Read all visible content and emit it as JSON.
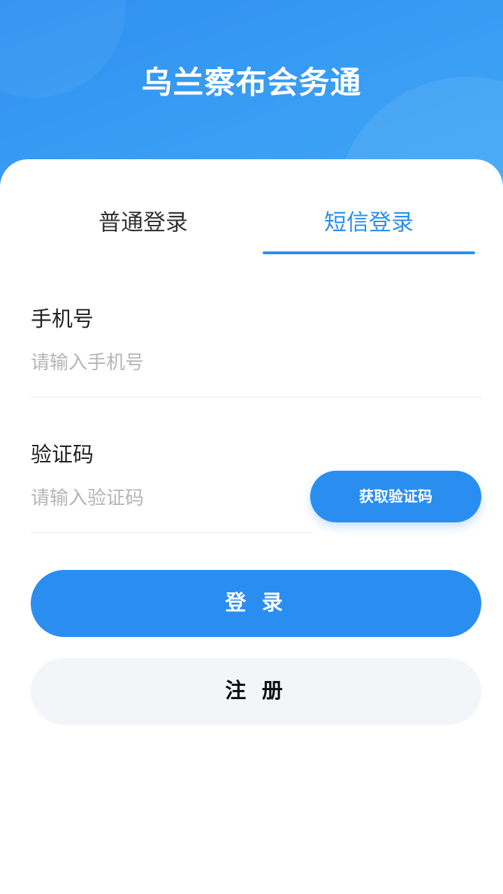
{
  "header": {
    "title": "乌兰察布会务通"
  },
  "tabs": [
    {
      "label": "普通登录",
      "active": false
    },
    {
      "label": "短信登录",
      "active": true
    }
  ],
  "form": {
    "phone": {
      "label": "手机号",
      "placeholder": "请输入手机号",
      "value": ""
    },
    "code": {
      "label": "验证码",
      "placeholder": "请输入验证码",
      "value": "",
      "button_label": "获取验证码"
    }
  },
  "actions": {
    "login_label": "登 录",
    "register_label": "注 册"
  },
  "colors": {
    "accent": "#2a8ef0",
    "header_gradient_start": "#2f8ff0",
    "header_gradient_end": "#3ea6f6",
    "secondary_button_bg": "#f4f5f9"
  }
}
